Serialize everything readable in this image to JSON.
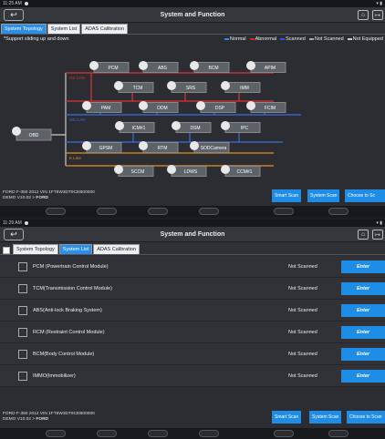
{
  "top": {
    "status_time": "11:25 AM",
    "title": "System and Function",
    "tabs": [
      "System Topology",
      "System List",
      "ADAS Calibration"
    ],
    "active_tab": 0,
    "hint": "*Support sliding up and down",
    "legend": [
      {
        "label": "Normal",
        "color": "#2a8fe8"
      },
      {
        "label": "Abnormal",
        "color": "#e02020"
      },
      {
        "label": "Scanned",
        "color": "#3050ff"
      },
      {
        "label": "Not Scanned",
        "color": "#aaaaaa"
      },
      {
        "label": "Not Equipped",
        "color": "#cccccc"
      }
    ],
    "bus_labels": [
      "HS CAN",
      "MS CAN",
      "K Line"
    ],
    "root_node": "OBD",
    "nodes": [
      "PCM",
      "ABS",
      "BCM",
      "APIM",
      "TCM",
      "SRS",
      "IMM",
      "PAM",
      "DDM",
      "DSP",
      "FCIM",
      "ICM#1",
      "DSM",
      "IPC",
      "GPSM",
      "RTM",
      "SODCamera",
      "SCCM",
      "LDWS",
      "CCM#1"
    ],
    "vehicle_line1": "FORD  F-350  2012  VIN  1FT8W3DT9CEB00000",
    "vehicle_line2_prefix": "DEMO V10.02 > ",
    "vehicle_line2_brand": "FORD",
    "buttons": [
      "Smart Scan",
      "System Scan",
      "Choose to Sc"
    ]
  },
  "bottom": {
    "status_time": "11:29 AM",
    "title": "System and Function",
    "tabs": [
      "System Topology",
      "System List",
      "ADAS Calibration"
    ],
    "active_tab": 1,
    "rows": [
      {
        "name": "PCM (Powertrain Control Module)",
        "status": "Not Scanned",
        "action": "Enter"
      },
      {
        "name": "TCM(Transmission Control Module)",
        "status": "Not Scanned",
        "action": "Enter"
      },
      {
        "name": "ABS(Anti-lock Braking System)",
        "status": "Not Scanned",
        "action": "Enter"
      },
      {
        "name": "RCM (Restraint Control Module)",
        "status": "Not Scanned",
        "action": "Enter"
      },
      {
        "name": "BCM(Body Control Module)",
        "status": "Not Scanned",
        "action": "Enter"
      },
      {
        "name": "IMMO(Immobilizer)",
        "status": "Not Scanned",
        "action": "Enter"
      }
    ],
    "vehicle_line1": "FORD  F-350  2012  VIN  1FT8W3DT9CEB00000",
    "vehicle_line2_prefix": "DEMO V10.02 > ",
    "vehicle_line2_brand": "FORD",
    "buttons": [
      "Smart Scan",
      "System Scan",
      "Choose to Scan"
    ]
  }
}
